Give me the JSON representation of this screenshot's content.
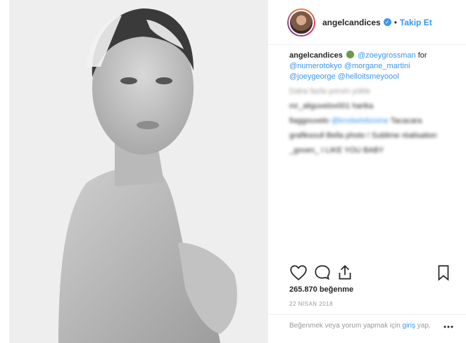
{
  "header": {
    "username": "angelcandices",
    "separator": "•",
    "follow_label": "Takip Et"
  },
  "caption": {
    "username": "angelcandices",
    "mention_1": "@zoeygrossman",
    "connector": "for",
    "mention_2": "@numerotokyo",
    "mention_3": "@morgane_martini",
    "mention_4": "@joeygeorge",
    "mention_5": "@helloitsmeyoool"
  },
  "comments": {
    "load_more": "Daha fazla yorum yükle",
    "c1": "mr_aliguvelov001 harika",
    "c2_user": "fiaggouvelo",
    "c2_mention": "@knobelvboxine",
    "c2_text": "Tacacara",
    "c3": "grafiksoull Bella photo ! Sublime réalisation",
    "c4": "_goven_ I LIKE YOU BABY"
  },
  "engagement": {
    "likes": "265.870 beğenme",
    "date": "22 NİSAN 2018"
  },
  "footer": {
    "prompt": "Beğenmek veya yorum yapmak için",
    "link": "giriş",
    "tail": "yap."
  },
  "icons": {
    "like": "heart-outline",
    "comment": "speech-bubble",
    "share": "share-upload",
    "save": "bookmark",
    "more": "ellipsis"
  }
}
